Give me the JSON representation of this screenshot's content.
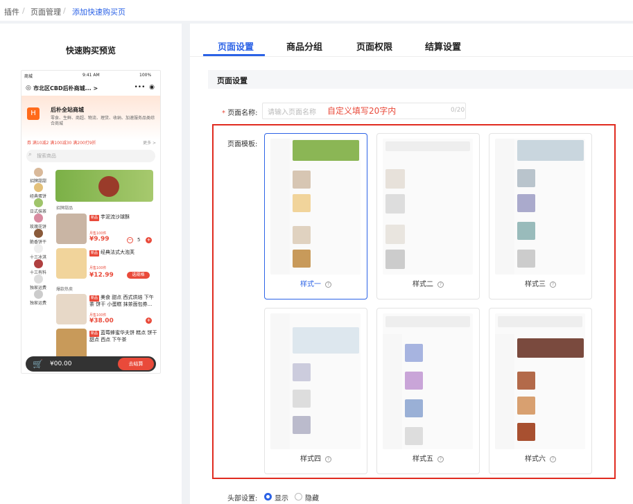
{
  "breadcrumb": [
    "插件",
    "页面管理",
    "添加快速购买页"
  ],
  "preview": {
    "title": "快速购买预览",
    "status": {
      "carrier": "商城",
      "time": "9:41 AM",
      "battery": "100%"
    },
    "location": "市北区CBD后朴商城... >",
    "shop_name": "后朴全站商城",
    "shop_desc": "零食、生鲜、商超、物流、理货、收纳、加速服务品类综合商城",
    "coupons": "券 满10减2  满100减30  满200打9折",
    "coupon_more": "更多 >",
    "search_placeholder": "搜索商品",
    "categories": [
      "招牌甜甜",
      "经典蛋饼",
      "日式抹茶",
      "玫瑰花饼",
      "脆香饼干",
      "十三冰淇",
      "十三有料",
      "独家运费",
      "独家运费"
    ],
    "group1": "招牌甜品",
    "group2": "爆款热卖",
    "products": [
      {
        "tag": "新品",
        "name": "芋泥流沙球酥",
        "sold": "月售100件",
        "price": "¥9.99",
        "qty": "5"
      },
      {
        "tag": "新品",
        "name": "经典法式大泡芙",
        "sold": "月售100件",
        "price": "¥12.99",
        "action": "选规格"
      },
      {
        "tag": "新品",
        "name": "美食 甜点 西式烘焙 下午茶 饼干 小蛋糕 抹茶面包券...",
        "sold": "月售100件",
        "price": "¥38.00"
      },
      {
        "tag": "新品",
        "name": "蓝莓蜂蜜华夫饼 糕点 饼干 甜点 西点 下午茶",
        "sold": "",
        "price": ""
      }
    ],
    "cart_total": "¥00.00",
    "checkout": "去结算"
  },
  "tabs": [
    "页面设置",
    "商品分组",
    "页面权限",
    "结算设置"
  ],
  "section_title": "页面设置",
  "form": {
    "name_label": "页面名称:",
    "name_placeholder": "请输入页面名称",
    "name_hint": "自定义填写20字内",
    "name_count": "0/20",
    "template_label": "页面模板:",
    "styles": [
      "样式一",
      "样式二",
      "样式三",
      "样式四",
      "样式五",
      "样式六"
    ],
    "help_glyph": "?",
    "header_label": "头部设置:",
    "header_options": [
      "显示",
      "隐藏"
    ]
  },
  "colors": {
    "accent": "#2b62e6",
    "price_red": "#e94a3a",
    "frame_red": "#e02a1f"
  }
}
